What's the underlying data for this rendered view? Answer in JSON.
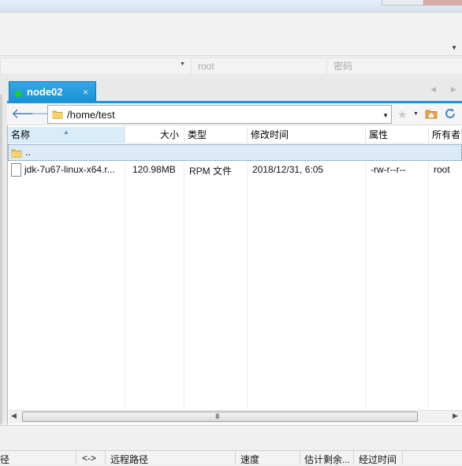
{
  "connection": {
    "user_placeholder": "root",
    "password_placeholder": "密码"
  },
  "tab": {
    "label": "node02",
    "close": "×",
    "status_color": "#1cd41c"
  },
  "address": {
    "path": "/home/test"
  },
  "columns": [
    "名称",
    "大小",
    "类型",
    "修改时间",
    "属性",
    "所有者"
  ],
  "rows": [
    {
      "name": ".."
    },
    {
      "name": "jdk-7u67-linux-x64.r...",
      "size": "120.98MB",
      "type": "RPM 文件",
      "modified": "2018/12/31, 6:05",
      "attributes": "-rw-r--r--",
      "owner": "root"
    }
  ],
  "transfer_columns": [
    "径",
    "<->",
    "远程路径",
    "速度",
    "估计剩余...",
    "经过时间"
  ],
  "scrollbar": {
    "grip": "III"
  },
  "icons": {
    "back": "back-arrow-icon",
    "forward": "forward-arrow-icon",
    "folder": "folder-icon",
    "favorite": "star-icon",
    "home": "home-folder-icon",
    "refresh": "refresh-icon",
    "file": "file-icon"
  },
  "colors": {
    "tab_accent": "#1c93d6",
    "selection": "#ddeaf8"
  }
}
